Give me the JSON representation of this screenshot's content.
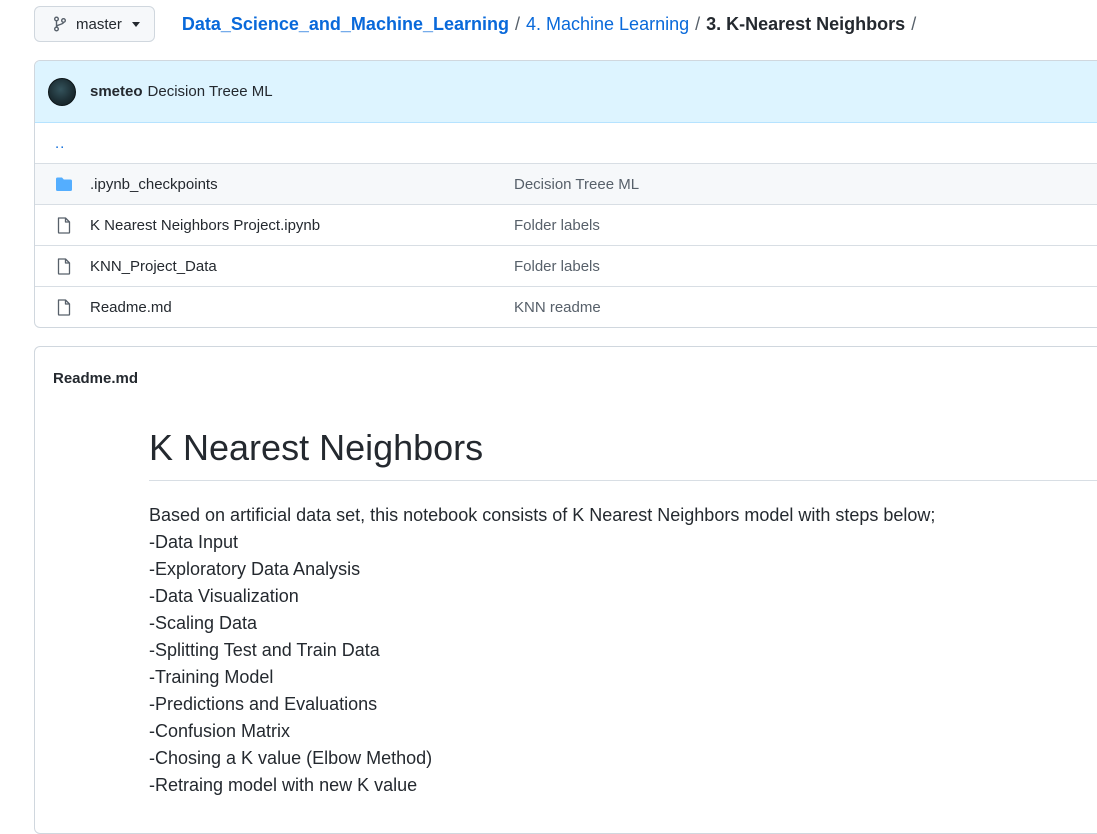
{
  "branch": {
    "name": "master",
    "icon": "git-branch-icon"
  },
  "breadcrumb": {
    "repo": "Data_Science_and_Machine_Learning",
    "folder": "4. Machine Learning",
    "current": "3. K-Nearest Neighbors",
    "separator": "/"
  },
  "commit": {
    "author": "smeteo",
    "message": "Decision Treee ML"
  },
  "files": {
    "up": "..",
    "rows": [
      {
        "name": ".ipynb_checkpoints",
        "type": "folder",
        "icon": "folder-icon",
        "commit": "Decision Treee ML"
      },
      {
        "name": "K Nearest Neighbors Project.ipynb",
        "type": "file",
        "icon": "file-icon",
        "commit": "Folder labels"
      },
      {
        "name": "KNN_Project_Data",
        "type": "file",
        "icon": "file-icon",
        "commit": "Folder labels"
      },
      {
        "name": "Readme.md",
        "type": "file",
        "icon": "file-icon",
        "commit": "KNN readme"
      }
    ]
  },
  "readme": {
    "filename": "Readme.md",
    "title": "K Nearest Neighbors",
    "intro": "Based on artificial data set, this notebook consists of K Nearest Neighbors model with steps below;",
    "steps": [
      "-Data Input",
      "-Exploratory Data Analysis",
      "-Data Visualization",
      "-Scaling Data",
      "-Splitting Test and Train Data",
      "-Training Model",
      "-Predictions and Evaluations",
      "-Confusion Matrix",
      "-Chosing a K value (Elbow Method)",
      "-Retraing model with new K value"
    ]
  },
  "colors": {
    "link": "#0969da",
    "folder": "#54aeff",
    "commit_bar": "#ddf4ff"
  }
}
